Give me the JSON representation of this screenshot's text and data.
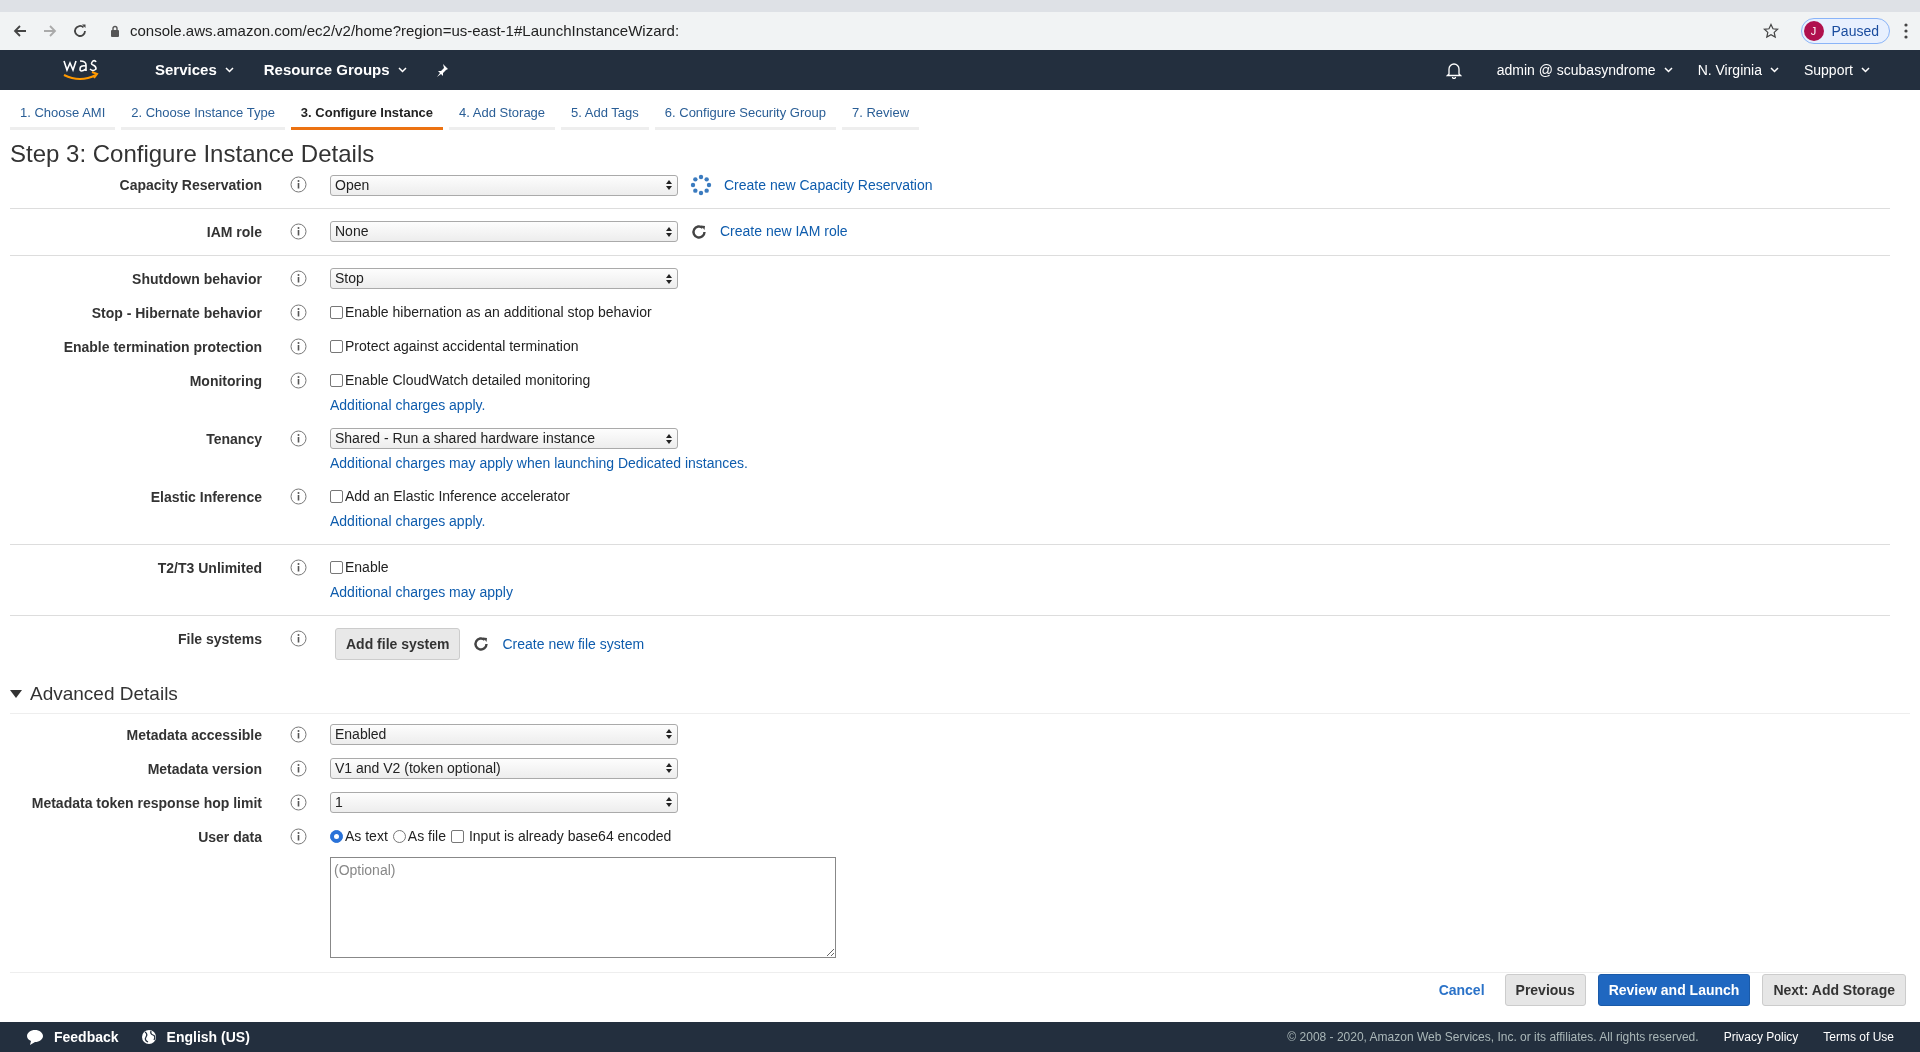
{
  "browser": {
    "url": "console.aws.amazon.com/ec2/v2/home?region=us-east-1#LaunchInstanceWizard:",
    "profile": {
      "initial": "J",
      "label": "Paused"
    }
  },
  "nav": {
    "services": "Services",
    "resource_groups": "Resource Groups",
    "user": "admin @ scubasyndrome",
    "region": "N. Virginia",
    "support": "Support"
  },
  "wizard_tabs": [
    {
      "label": "1. Choose AMI",
      "selected": false
    },
    {
      "label": "2. Choose Instance Type",
      "selected": false
    },
    {
      "label": "3. Configure Instance",
      "selected": true
    },
    {
      "label": "4. Add Storage",
      "selected": false
    },
    {
      "label": "5. Add Tags",
      "selected": false
    },
    {
      "label": "6. Configure Security Group",
      "selected": false
    },
    {
      "label": "7. Review",
      "selected": false
    }
  ],
  "title": "Step 3: Configure Instance Details",
  "groups": [
    [
      {
        "label": "Capacity Reservation",
        "kind": "select",
        "value": "Open",
        "link": {
          "kind": "reservation",
          "text": "Create new Capacity Reservation"
        }
      }
    ],
    [
      {
        "label": "IAM role",
        "kind": "select",
        "value": "None",
        "link": {
          "kind": "refresh",
          "text": "Create new IAM role"
        }
      }
    ],
    [
      {
        "label": "Shutdown behavior",
        "kind": "select",
        "value": "Stop"
      },
      {
        "label": "Stop - Hibernate behavior",
        "kind": "checkbox",
        "text": "Enable hibernation as an additional stop behavior",
        "checked": false
      },
      {
        "label": "Enable termination protection",
        "kind": "checkbox",
        "text": "Protect against accidental termination",
        "checked": false
      },
      {
        "label": "Monitoring",
        "kind": "checkbox",
        "text": "Enable CloudWatch detailed monitoring",
        "checked": false,
        "note": "Additional charges apply."
      },
      {
        "label": "Tenancy",
        "kind": "select",
        "value": "Shared - Run a shared hardware instance",
        "note": "Additional charges may apply when launching Dedicated instances."
      },
      {
        "label": "Elastic Inference",
        "kind": "checkbox",
        "text": "Add an Elastic Inference accelerator",
        "checked": false,
        "note": "Additional charges apply."
      }
    ],
    [
      {
        "label": "T2/T3 Unlimited",
        "kind": "checkbox",
        "text": "Enable",
        "checked": false,
        "note": "Additional charges may apply"
      }
    ],
    [
      {
        "label": "File systems",
        "kind": "button",
        "text": "Add file system",
        "link": {
          "kind": "refresh",
          "text": "Create new file system"
        }
      }
    ]
  ],
  "advanced": {
    "title": "Advanced Details",
    "expanded": true,
    "rows": [
      {
        "label": "Metadata accessible",
        "kind": "select",
        "value": "Enabled"
      },
      {
        "label": "Metadata version",
        "kind": "select",
        "value": "V1 and V2 (token optional)"
      },
      {
        "label": "Metadata token response hop limit",
        "kind": "select",
        "value": "1"
      },
      {
        "label": "User data",
        "kind": "userdata",
        "options": [
          {
            "label": "As text",
            "selected": true
          },
          {
            "label": "As file",
            "selected": false
          }
        ],
        "encoded": {
          "text": "Input is already base64 encoded",
          "checked": false
        },
        "placeholder": "(Optional)"
      }
    ]
  },
  "actions": [
    {
      "label": "Cancel",
      "kind": "link"
    },
    {
      "label": "Previous",
      "kind": "secondary"
    },
    {
      "label": "Review and Launch",
      "kind": "primary"
    },
    {
      "label": "Next: Add Storage",
      "kind": "secondary"
    }
  ],
  "footer": {
    "feedback": "Feedback",
    "language": "English (US)",
    "copyright": "© 2008 - 2020, Amazon Web Services, Inc. or its affiliates. All rights reserved.",
    "links": [
      "Privacy Policy",
      "Terms of Use"
    ]
  }
}
